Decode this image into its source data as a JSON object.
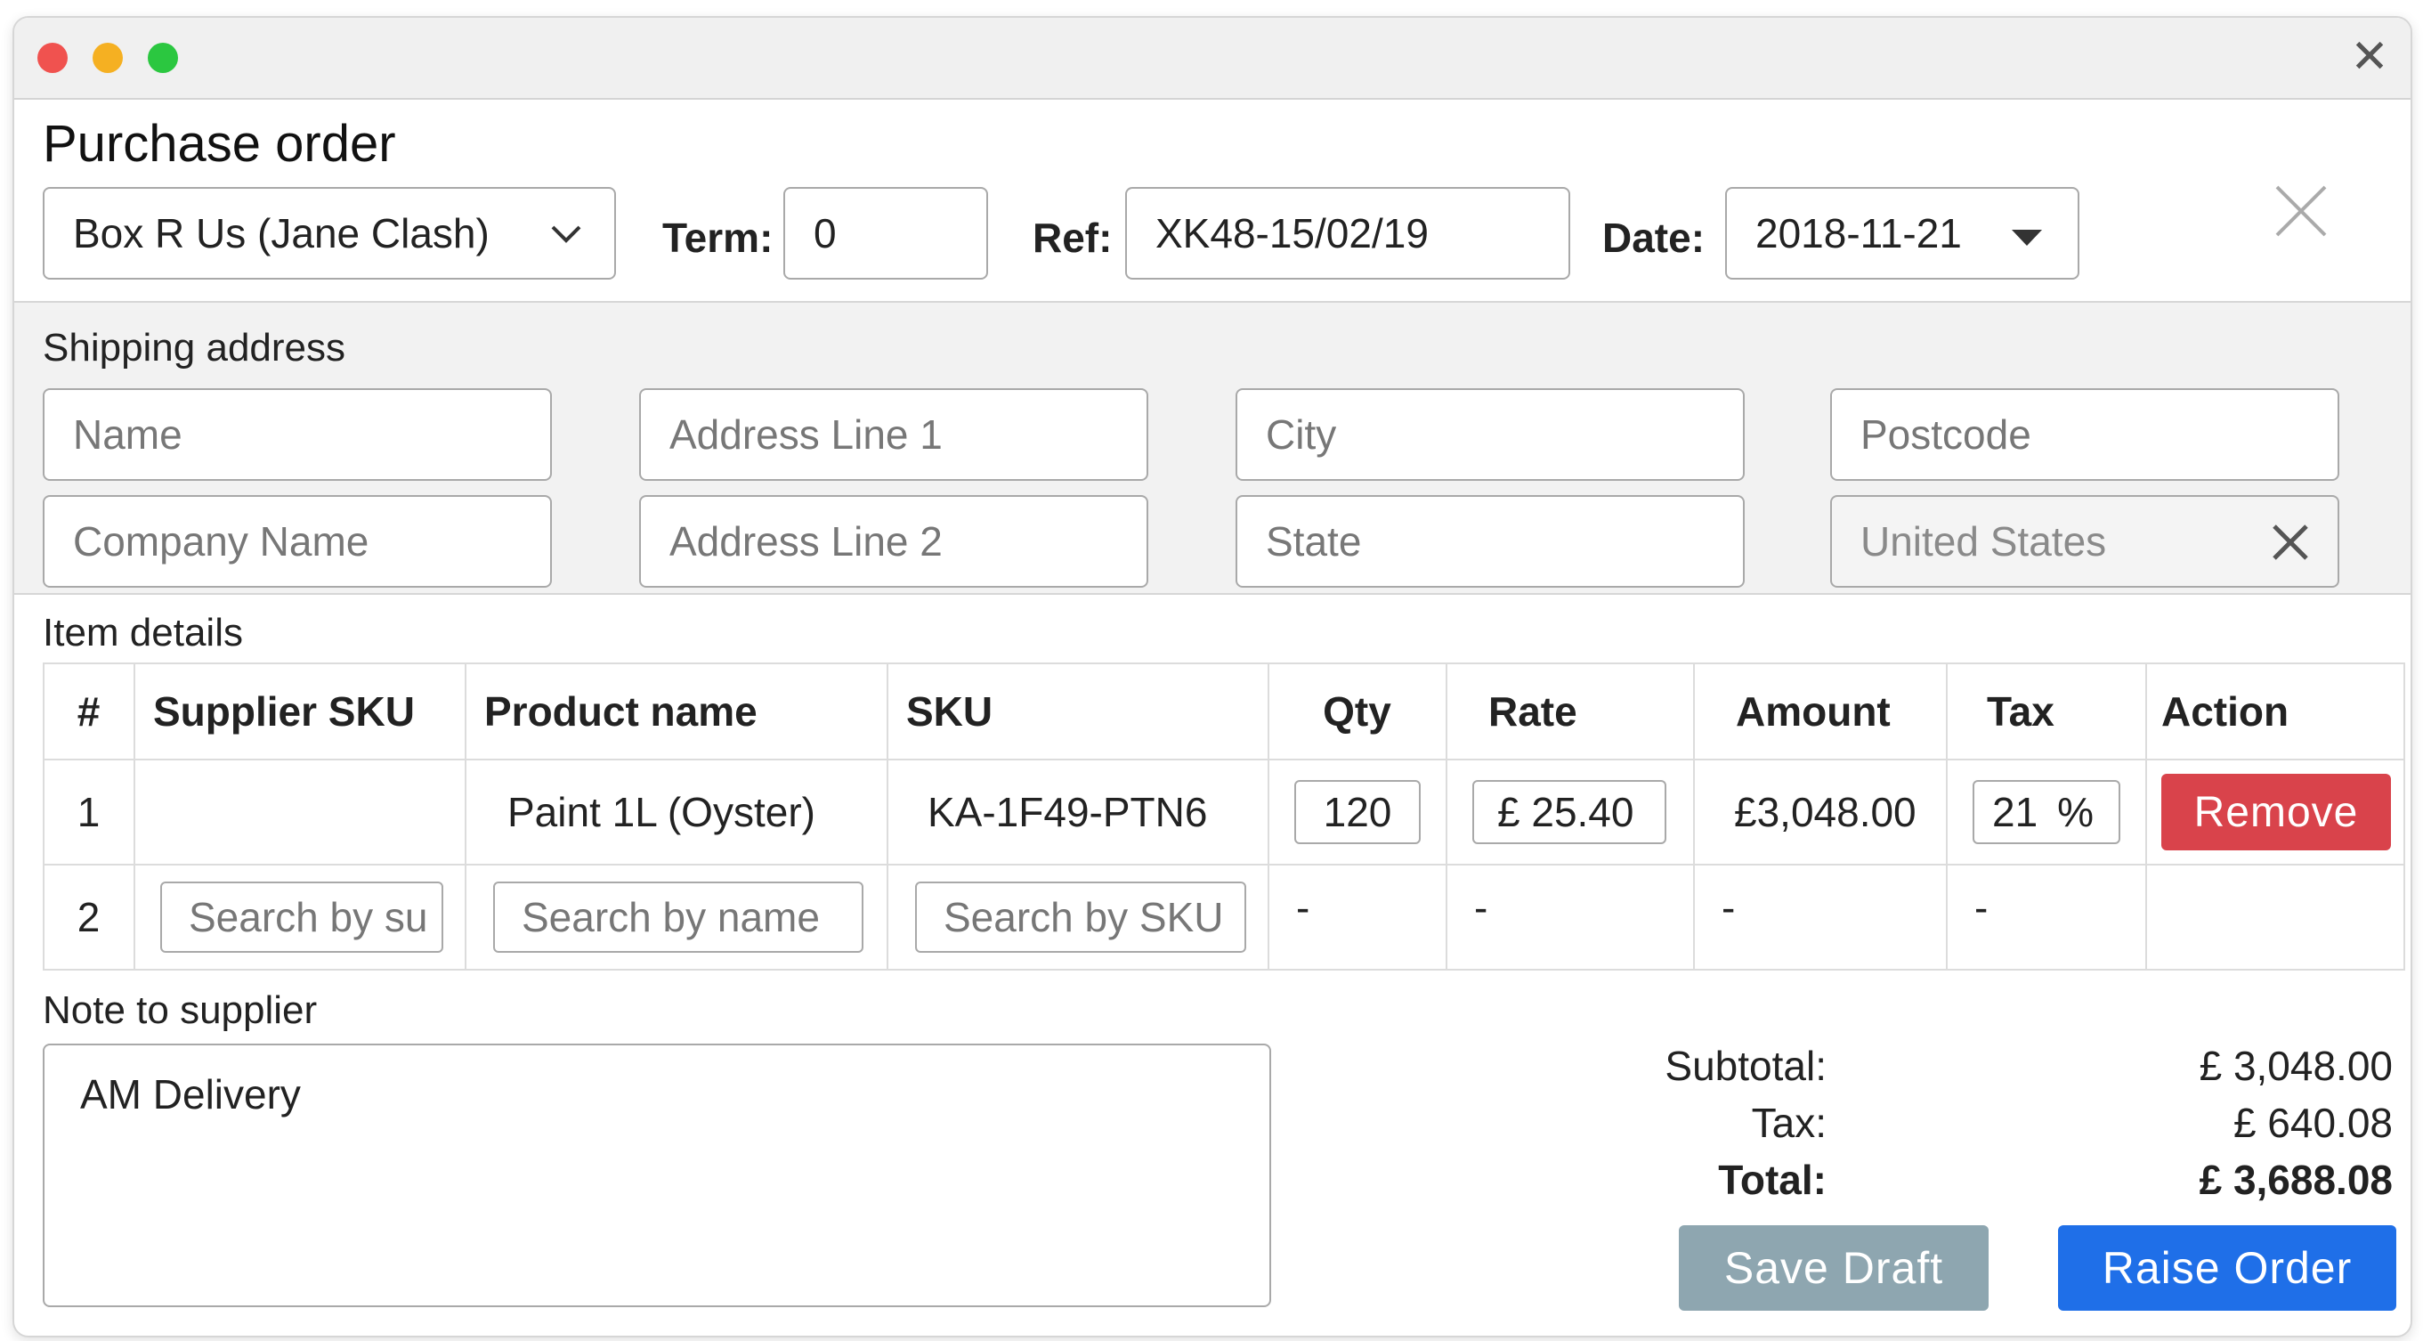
{
  "window": {
    "traffic_lights": {
      "close": "#f0524f",
      "minimize": "#f5b022",
      "zoom": "#2bc740"
    },
    "close_icon": "close-icon"
  },
  "header": {
    "title": "Purchase order",
    "supplier_value": "Box R Us (Jane Clash)",
    "term_label": "Term:",
    "term_value": "0",
    "ref_label": "Ref:",
    "ref_value": "XK48-15/02/19",
    "date_label": "Date:",
    "date_value": "2018-11-21",
    "close_icon": "x-icon"
  },
  "shipping": {
    "title": "Shipping address",
    "name_placeholder": "Name",
    "company_placeholder": "Company Name",
    "address1_placeholder": "Address Line 1",
    "address2_placeholder": "Address Line 2",
    "city_placeholder": "City",
    "state_placeholder": "State",
    "postcode_placeholder": "Postcode",
    "country_value": "United States"
  },
  "items": {
    "title": "Item details",
    "columns": [
      "#",
      "Supplier SKU",
      "Product name",
      "SKU",
      "Qty",
      "Rate",
      "Amount",
      "Tax",
      "Action"
    ],
    "rows": [
      {
        "num": "1",
        "supplier_sku": "",
        "product": "Paint 1L (Oyster)",
        "sku": "KA-1F49-PTN6",
        "qty": "120",
        "rate": "£ 25.40",
        "amount": "£3,048.00",
        "tax": "21",
        "tax_unit": "%",
        "action": "Remove"
      },
      {
        "num": "2",
        "supplier_sku_placeholder": "Search by su",
        "product_placeholder": "Search by name",
        "sku_placeholder": "Search by SKU",
        "qty": "-",
        "rate": "-",
        "amount": "-",
        "tax": "-"
      }
    ]
  },
  "note": {
    "title": "Note to supplier",
    "value": "AM Delivery"
  },
  "totals": {
    "subtotal_label": "Subtotal:",
    "subtotal_value": "£ 3,048.00",
    "tax_label": "Tax:",
    "tax_value": "£ 640.08",
    "total_label": "Total:",
    "total_value": "£ 3,688.08"
  },
  "actions": {
    "save_draft": "Save Draft",
    "raise_order": "Raise Order",
    "colors": {
      "remove": "#d9434b",
      "save_draft": "#8ea6b0",
      "raise_order": "#1f6fe8"
    }
  }
}
